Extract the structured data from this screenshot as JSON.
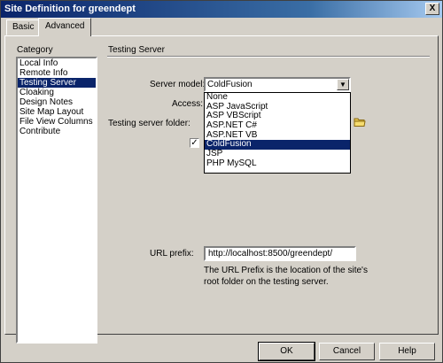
{
  "window": {
    "title": "Site Definition for greendept",
    "close_glyph": "X"
  },
  "tabs": [
    {
      "label": "Basic"
    },
    {
      "label": "Advanced"
    }
  ],
  "category": {
    "label": "Category",
    "items": [
      {
        "label": "Local Info"
      },
      {
        "label": "Remote Info"
      },
      {
        "label": "Testing Server"
      },
      {
        "label": "Cloaking"
      },
      {
        "label": "Design Notes"
      },
      {
        "label": "Site Map Layout"
      },
      {
        "label": "File View Columns"
      },
      {
        "label": "Contribute"
      }
    ],
    "selected": "Testing Server"
  },
  "section": {
    "title": "Testing Server"
  },
  "form": {
    "server_model_label": "Server model:",
    "server_model_value": "ColdFusion",
    "server_model_options": [
      {
        "label": "None"
      },
      {
        "label": "ASP JavaScript"
      },
      {
        "label": "ASP VBScript"
      },
      {
        "label": "ASP.NET C#"
      },
      {
        "label": "ASP.NET VB"
      },
      {
        "label": "ColdFusion"
      },
      {
        "label": "JSP"
      },
      {
        "label": "PHP MySQL"
      }
    ],
    "access_label": "Access:",
    "testing_folder_label": "Testing server folder:",
    "checkbox_mark": "✓",
    "url_prefix_label": "URL prefix:",
    "url_prefix_value": "http://localhost:8500/greendept/",
    "help_line1": "The URL Prefix is the location of the site's",
    "help_line2": "root folder on the testing server."
  },
  "buttons": {
    "ok": "OK",
    "cancel": "Cancel",
    "help": "Help"
  },
  "colors": {
    "selection": "#0a246a",
    "dialog_bg": "#d4d0c8"
  }
}
